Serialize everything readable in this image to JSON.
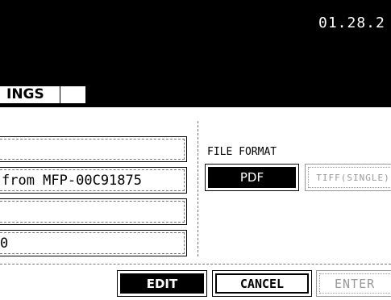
{
  "header": {
    "date": "01.28.2"
  },
  "tab": {
    "label": "INGS"
  },
  "fields": [
    {
      "value": ""
    },
    {
      "value": "from MFP-00C91875"
    },
    {
      "value": ""
    },
    {
      "value": "0"
    }
  ],
  "file_format": {
    "label": "FILE FORMAT",
    "options": [
      {
        "label": "PDF",
        "selected": true
      },
      {
        "label": "TIFF(SINGLE)",
        "selected": false
      }
    ]
  },
  "footer": {
    "edit_label": "EDIT",
    "cancel_label": "CANCEL",
    "enter_label": "ENTER"
  }
}
